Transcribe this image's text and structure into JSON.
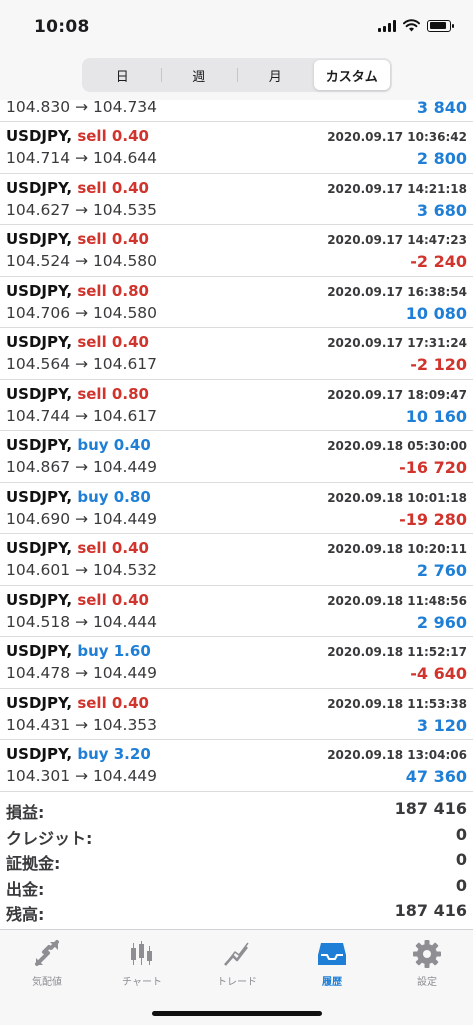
{
  "status_bar": {
    "time": "10:08"
  },
  "tabs": {
    "items": [
      {
        "label": "日",
        "active": false
      },
      {
        "label": "週",
        "active": false
      },
      {
        "label": "月",
        "active": false
      },
      {
        "label": "カスタム",
        "active": true
      }
    ]
  },
  "partial_row": {
    "prices": "104.830 → 104.734",
    "profit": "3 840"
  },
  "trades": [
    {
      "symbol": "USDJPY,",
      "action": "sell 0.40",
      "type": "sell",
      "time": "2020.09.17 10:36:42",
      "prices": "104.714 → 104.644",
      "profit": "2 800",
      "sign": "pos"
    },
    {
      "symbol": "USDJPY,",
      "action": "sell 0.40",
      "type": "sell",
      "time": "2020.09.17 14:21:18",
      "prices": "104.627 → 104.535",
      "profit": "3 680",
      "sign": "pos"
    },
    {
      "symbol": "USDJPY,",
      "action": "sell 0.40",
      "type": "sell",
      "time": "2020.09.17 14:47:23",
      "prices": "104.524 → 104.580",
      "profit": "-2 240",
      "sign": "neg"
    },
    {
      "symbol": "USDJPY,",
      "action": "sell 0.80",
      "type": "sell",
      "time": "2020.09.17 16:38:54",
      "prices": "104.706 → 104.580",
      "profit": "10 080",
      "sign": "pos"
    },
    {
      "symbol": "USDJPY,",
      "action": "sell 0.40",
      "type": "sell",
      "time": "2020.09.17 17:31:24",
      "prices": "104.564 → 104.617",
      "profit": "-2 120",
      "sign": "neg"
    },
    {
      "symbol": "USDJPY,",
      "action": "sell 0.80",
      "type": "sell",
      "time": "2020.09.17 18:09:47",
      "prices": "104.744 → 104.617",
      "profit": "10 160",
      "sign": "pos"
    },
    {
      "symbol": "USDJPY,",
      "action": "buy 0.40",
      "type": "buy",
      "time": "2020.09.18 05:30:00",
      "prices": "104.867 → 104.449",
      "profit": "-16 720",
      "sign": "neg"
    },
    {
      "symbol": "USDJPY,",
      "action": "buy 0.80",
      "type": "buy",
      "time": "2020.09.18 10:01:18",
      "prices": "104.690 → 104.449",
      "profit": "-19 280",
      "sign": "neg"
    },
    {
      "symbol": "USDJPY,",
      "action": "sell 0.40",
      "type": "sell",
      "time": "2020.09.18 10:20:11",
      "prices": "104.601 → 104.532",
      "profit": "2 760",
      "sign": "pos"
    },
    {
      "symbol": "USDJPY,",
      "action": "sell 0.40",
      "type": "sell",
      "time": "2020.09.18 11:48:56",
      "prices": "104.518 → 104.444",
      "profit": "2 960",
      "sign": "pos"
    },
    {
      "symbol": "USDJPY,",
      "action": "buy 1.60",
      "type": "buy",
      "time": "2020.09.18 11:52:17",
      "prices": "104.478 → 104.449",
      "profit": "-4 640",
      "sign": "neg"
    },
    {
      "symbol": "USDJPY,",
      "action": "sell 0.40",
      "type": "sell",
      "time": "2020.09.18 11:53:38",
      "prices": "104.431 → 104.353",
      "profit": "3 120",
      "sign": "pos"
    },
    {
      "symbol": "USDJPY,",
      "action": "buy 3.20",
      "type": "buy",
      "time": "2020.09.18 13:04:06",
      "prices": "104.301 → 104.449",
      "profit": "47 360",
      "sign": "pos"
    }
  ],
  "summary": [
    {
      "label": "損益:",
      "value": "187 416"
    },
    {
      "label": "クレジット:",
      "value": "0"
    },
    {
      "label": "証拠金:",
      "value": "0"
    },
    {
      "label": "出金:",
      "value": "0"
    },
    {
      "label": "残高:",
      "value": "187 416"
    }
  ],
  "tabbar": {
    "items": [
      {
        "label": "気配値",
        "icon": "quotes-icon",
        "active": false
      },
      {
        "label": "チャート",
        "icon": "chart-icon",
        "active": false
      },
      {
        "label": "トレード",
        "icon": "trade-icon",
        "active": false
      },
      {
        "label": "履歴",
        "icon": "history-icon",
        "active": true
      },
      {
        "label": "設定",
        "icon": "gear-icon",
        "active": false
      }
    ]
  },
  "colors": {
    "sell": "#d0342c",
    "buy": "#1f7fd6",
    "positive": "#1f7fd6",
    "negative": "#d0342c",
    "active_tab": "#1f7fd6"
  }
}
